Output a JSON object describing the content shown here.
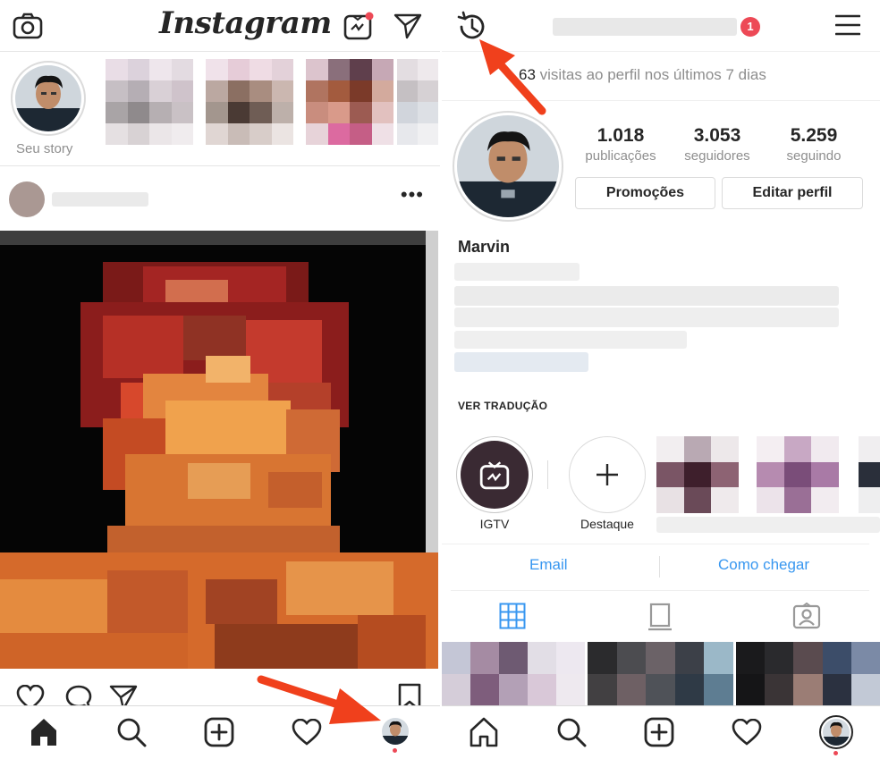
{
  "colors": {
    "accent_red": "#ed4956",
    "link_blue": "#3897f0",
    "arrow_red": "#f0401c",
    "secondary_text": "#8e8e8e"
  },
  "feed": {
    "logo": "Instagram",
    "your_story_label": "Seu story",
    "more_options": "•••",
    "icons": [
      "camera-icon",
      "igtv-icon",
      "direct-message-icon",
      "heart-icon",
      "comment-icon",
      "share-icon",
      "bookmark-icon"
    ]
  },
  "profile": {
    "visits_count": "63",
    "visits_text": " visitas ao perfil nos últimos 7 dias",
    "notification_count": "1",
    "stats": [
      {
        "value": "1.018",
        "label": "publicações"
      },
      {
        "value": "3.053",
        "label": "seguidores"
      },
      {
        "value": "5.259",
        "label": "seguindo"
      }
    ],
    "promotions_button": "Promoções",
    "edit_profile_button": "Editar perfil",
    "name": "Marvin",
    "see_translation": "VER TRADUÇÃO",
    "highlights": [
      {
        "label": "IGTV"
      },
      {
        "label": "Destaque"
      }
    ],
    "email_button": "Email",
    "directions_button": "Como chegar"
  },
  "tabbar": {
    "items": [
      "home-icon",
      "search-icon",
      "new-post-icon",
      "activity-icon",
      "profile-icon"
    ]
  }
}
